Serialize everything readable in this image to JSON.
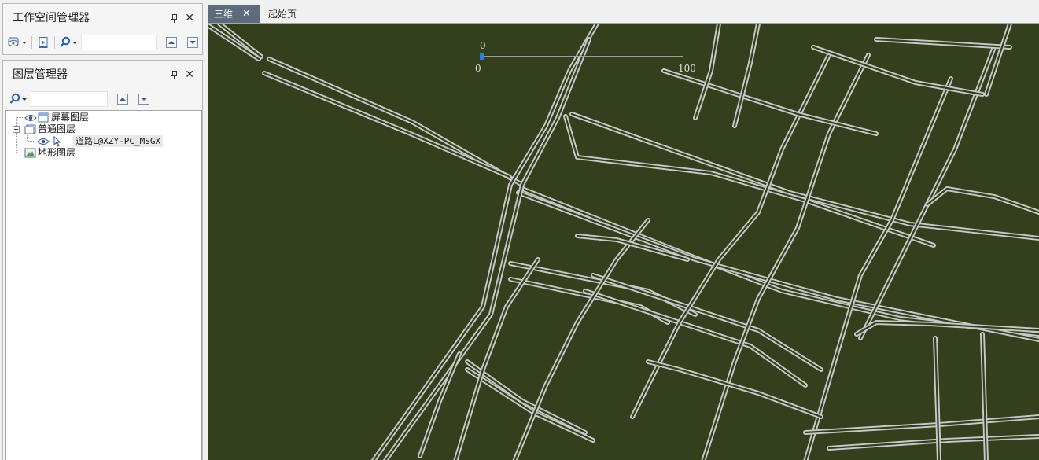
{
  "workspace_panel": {
    "title": "工作空间管理器"
  },
  "layer_panel": {
    "title": "图层管理器",
    "tree": [
      {
        "label": "屏幕图层"
      },
      {
        "label": "普通图层"
      },
      {
        "label": "道路L@XZY-PC_MSGX"
      },
      {
        "label": "地形图层"
      }
    ]
  },
  "tabs": [
    {
      "label": "三维",
      "active": true
    },
    {
      "label": "起始页",
      "active": false
    }
  ],
  "scene": {
    "background": "#333f1d",
    "road_color": "#c9c9c9",
    "slider": {
      "value": 0,
      "min": 0,
      "max": 100
    }
  }
}
